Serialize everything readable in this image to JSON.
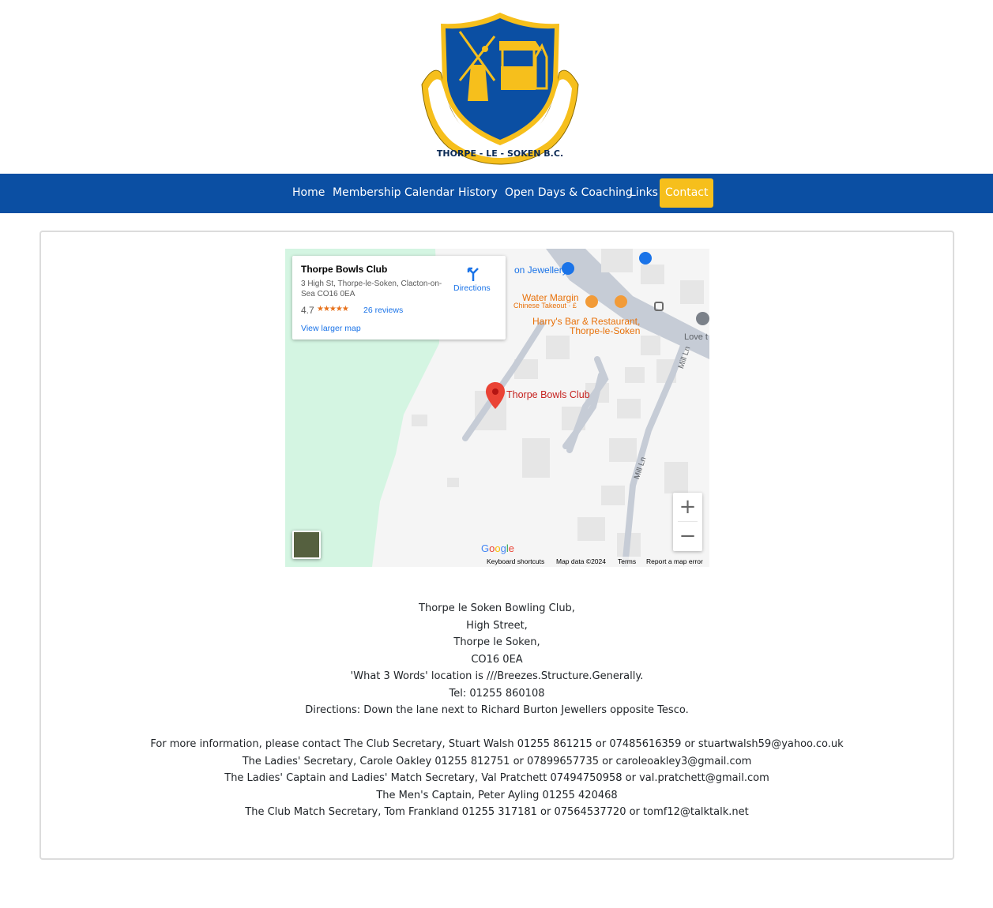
{
  "logo": {
    "text": "THORPE - LE - SOKEN B.C.",
    "colors": {
      "shield": "#0b4fa3",
      "gold": "#f6bf1c",
      "ribbon": "#ffffff"
    }
  },
  "nav": {
    "items": [
      {
        "label": "Home"
      },
      {
        "label": "Membership"
      },
      {
        "label": "Calendar"
      },
      {
        "label": "History"
      },
      {
        "label": "Open Days & Coaching"
      },
      {
        "label": "Links"
      },
      {
        "label": "Contact",
        "active": true
      }
    ],
    "colors": {
      "bar": "#0b4fa3",
      "active": "#f6bf1c"
    }
  },
  "map": {
    "place_name": "Thorpe Bowls Club",
    "address": "3 High St, Thorpe-le-Soken, Clacton-on-Sea CO16 0EA",
    "rating": "4.7",
    "stars": "★★★★★",
    "reviews": "26 reviews",
    "view_larger": "View larger map",
    "directions": "Directions",
    "marker_label": "Thorpe Bowls Club",
    "poi": {
      "jewellery": "on Jewellery",
      "water_margin": "Water Margin",
      "water_margin_sub": "Chinese Takeout · £",
      "harrys_1": "Harry's Bar & Restaurant,",
      "harrys_2": "Thorpe-le-Soken",
      "love": "Love t",
      "street_1": "Mill Ln",
      "street_2": "Mill Ln"
    },
    "zoom_in": "+",
    "zoom_out": "−",
    "google": "Google",
    "footer": {
      "shortcuts": "Keyboard shortcuts",
      "data": "Map data ©2024",
      "terms": "Terms",
      "report": "Report a map error"
    }
  },
  "contact": {
    "address_lines": [
      "Thorpe le Soken Bowling Club,",
      "High Street,",
      "Thorpe le Soken,",
      "CO16 0EA",
      "'What 3 Words' location is ///Breezes.Structure.Generally.",
      "Tel: 01255 860108",
      "Directions: Down the lane next to Richard Burton Jewellers opposite Tesco."
    ],
    "info_lines": [
      "For more information, please contact The Club Secretary, Stuart Walsh 01255 861215 or 07485616359 or stuartwalsh59@yahoo.co.uk",
      "The Ladies' Secretary, Carole Oakley 01255 812751 or 07899657735 or caroleoakley3@gmail.com",
      "The Ladies' Captain and Ladies' Match Secretary, Val Pratchett 07494750958 or val.pratchett@gmail.com",
      "The Men's Captain, Peter Ayling 01255 420468",
      "The Club Match Secretary, Tom Frankland 01255 317181 or 07564537720 or tomf12@talktalk.net"
    ]
  }
}
